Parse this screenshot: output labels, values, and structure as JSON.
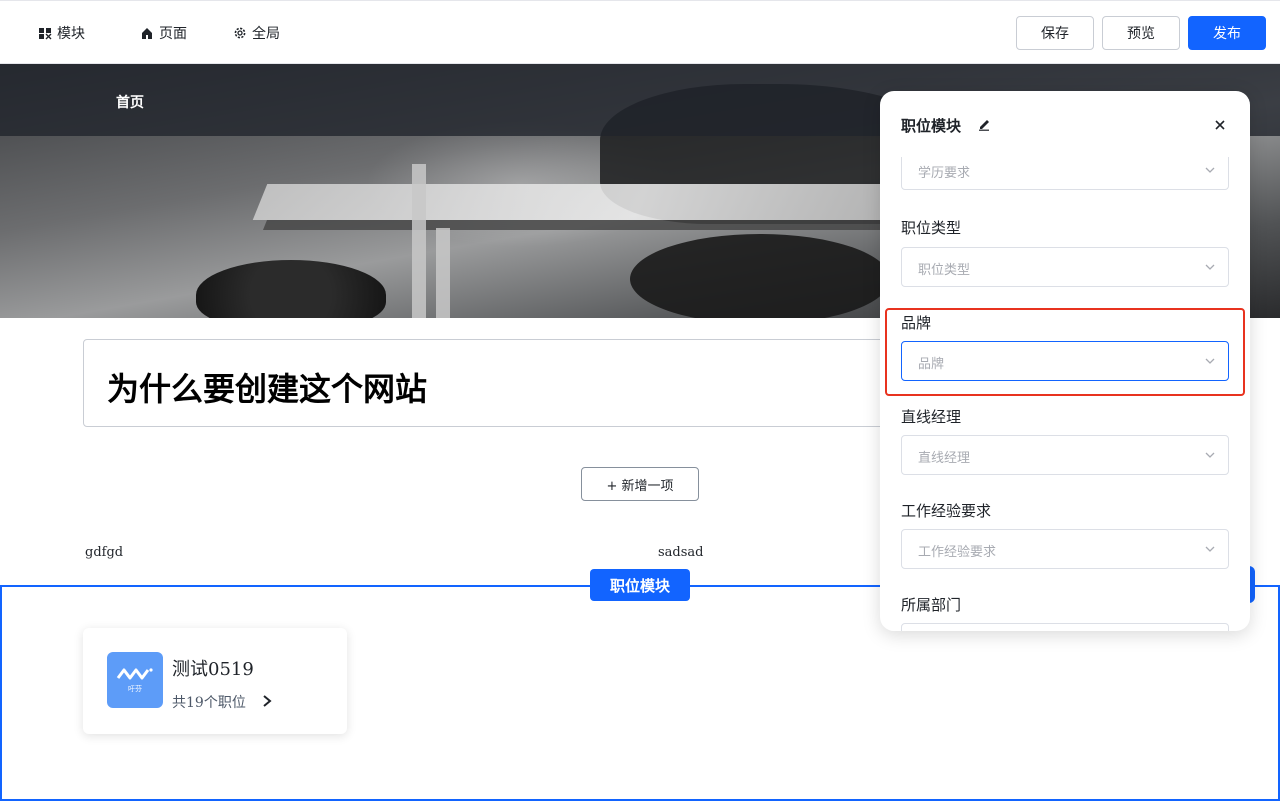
{
  "toolbar": {
    "nav": [
      {
        "label": "模块",
        "icon": "module-icon"
      },
      {
        "label": "页面",
        "icon": "home-icon"
      },
      {
        "label": "全局",
        "icon": "gear-icon"
      }
    ],
    "save_label": "保存",
    "preview_label": "预览",
    "publish_label": "发布"
  },
  "hero": {
    "nav_item": "首页"
  },
  "content": {
    "title": "为什么要创建这个网站",
    "add_label": "+ 新增一项",
    "columns": [
      "gdfgd",
      "sadsad"
    ]
  },
  "section": {
    "tag": "职位模块",
    "card": {
      "name": "测试0519",
      "jobs": "共19个职位",
      "logo_text": "吁芬"
    }
  },
  "panel": {
    "title": "职位模块",
    "fields": [
      {
        "label": "",
        "placeholder": "学历要求"
      },
      {
        "label": "职位类型",
        "placeholder": "职位类型"
      },
      {
        "label": "品牌",
        "placeholder": "品牌"
      },
      {
        "label": "直线经理",
        "placeholder": "直线经理"
      },
      {
        "label": "工作经验要求",
        "placeholder": "工作经验要求"
      },
      {
        "label": "所属部门",
        "placeholder": ""
      }
    ]
  },
  "colors": {
    "accent": "#1264ff",
    "highlight": "#e8331f"
  }
}
